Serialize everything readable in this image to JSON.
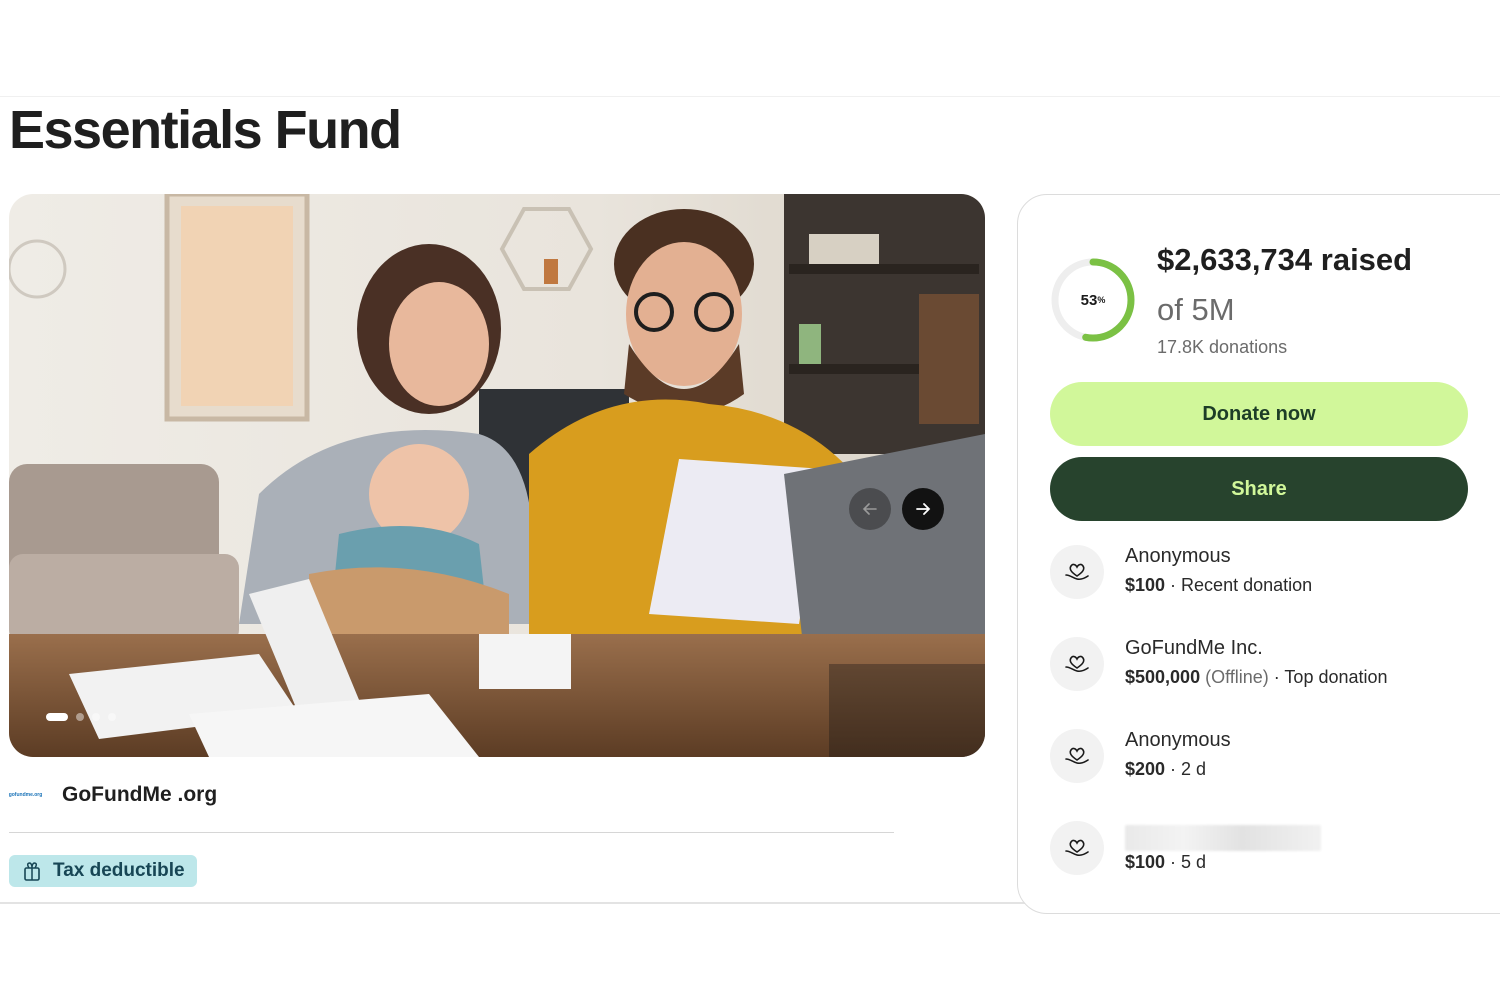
{
  "page": {
    "title": "Essentials Fund"
  },
  "carousel": {
    "slide_count": 4,
    "active_index": 0
  },
  "organizer": {
    "logo_text": "gofundme.org",
    "name": "GoFundMe .org"
  },
  "badge": {
    "label": "Tax deductible"
  },
  "progress": {
    "percent_value": 53,
    "percent_label": "53",
    "percent_sign": "%",
    "raised": "$2,633,734 raised",
    "goal": "of 5M",
    "donations": "17.8K donations",
    "ring_color": "#7bc144"
  },
  "actions": {
    "donate_label": "Donate now",
    "share_label": "Share"
  },
  "donors": [
    {
      "name": "Anonymous",
      "amount": "$100",
      "extra": "",
      "detail": " · Recent donation"
    },
    {
      "name": "GoFundMe Inc.",
      "amount": "$500,000",
      "extra": " (Offline)",
      "detail": " · Top donation"
    },
    {
      "name": "Anonymous",
      "amount": "$200",
      "extra": "",
      "detail": " · 2 d"
    },
    {
      "name": "",
      "amount": "$100",
      "extra": "",
      "detail": " · 5 d"
    }
  ],
  "colors": {
    "donate_bg": "#d1f79a",
    "share_bg": "#27432d",
    "badge_bg": "#bde7ea"
  }
}
